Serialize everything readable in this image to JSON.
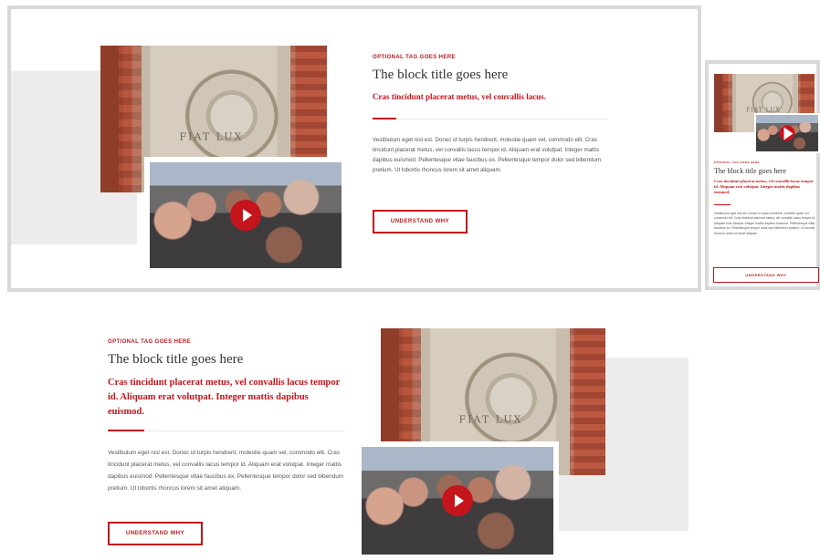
{
  "block_top": {
    "tag": "OPTIONAL TAG GOES HERE",
    "title": "The block title goes here",
    "subtitle": "Cras tincidunt placerat metus, vel convallis lacus.",
    "body": "Vestibulum eget nisl est. Donec id turpis hendrerit, molestie quam vel, commodo elit. Cras tincidunt placerat metus, vel convallis lacus tempor id. Aliquam erat volutpat. Integer mattis dapibus euismod. Pellentesque vitae faucibus ex. Pellentesque tempor dolor sed bibendum pretium. Ut lobortis rhoncus lorem sit amet aliquam.",
    "cta": "UNDERSTAND WHY"
  },
  "block_mobile": {
    "tag": "OPTIONAL TAG GOES HERE",
    "title": "The block title goes here",
    "subtitle": "Cras tincidunt placerat metus, vel convallis lacus tempor id. Aliquam erat volutpat. Integer mattis dapibus euismod.",
    "body": "Vestibulum eget nisl est. Donec id turpis hendrerit, molestie quam vel, commodo elit. Cras tincidunt placerat metus, vel convallis lacus tempor id. Aliquam erat volutpat. Integer mattis dapibus euismod. Pellentesque vitae faucibus ex. Pellentesque tempor dolor sed bibendum pretium. Ut lobortis rhoncus lorem sit amet aliquam.",
    "cta": "UNDERSTAND WHY"
  },
  "block_bottom": {
    "tag": "OPTIONAL TAG GOES HERE",
    "title": "The block title goes here",
    "subtitle": "Cras tincidunt placerat metus, vel convallis lacus tempor id. Aliquam erat volutpat. Integer mattis dapibus euismod.",
    "body": "Vestibulum eget nisl est. Donec id turpis hendrerit, molestie quam vel, commodo elit. Cras tincidunt placerat metus, vel convallis lacus tempor id. Aliquam erat volutpat. Integer mattis dapibus euismod. Pellentesque vitae faucibus ex. Pellentesque tempor dolor sed bibendum pretium. Ut lobortis rhoncus lorem sit amet aliquam.",
    "cta": "UNDERSTAND WHY"
  },
  "seal_text": "FIAT LUX",
  "icons": [
    "play-icon"
  ],
  "colors": {
    "accent": "#c4141c",
    "gray_band": "#ececec",
    "border": "#d9d9d9"
  }
}
